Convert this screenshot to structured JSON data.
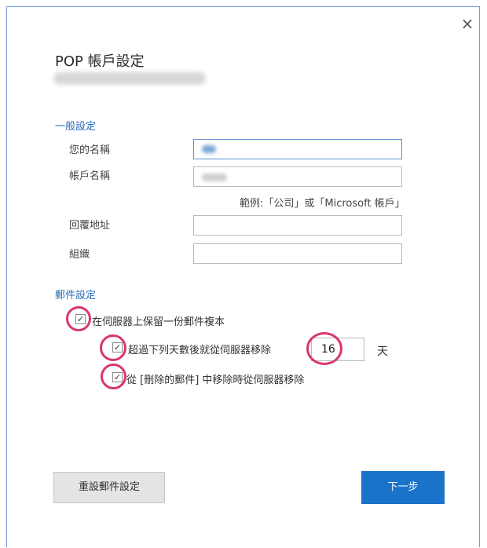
{
  "dialog": {
    "close_glyph": "×",
    "title": "POP 帳戶設定"
  },
  "general": {
    "section_title": "一般設定",
    "your_name_label": "您的名稱",
    "account_name_label": "帳戶名稱",
    "example_hint": "範例:「公司」或「Microsoft 帳戶」",
    "reply_address_label": "回覆地址",
    "organization_label": "組織"
  },
  "mail": {
    "section_title": "郵件設定",
    "keep_copy_label": "在伺服器上保留一份郵件複本",
    "keep_copy_checked": true,
    "remove_after_label": "超過下列天數後就從伺服器移除",
    "remove_after_checked": true,
    "days_value": "16",
    "days_unit": "天",
    "remove_on_delete_label": "從 [刪除的郵件] 中移除時從伺服器移除",
    "remove_on_delete_checked": true,
    "check_glyph": "✓"
  },
  "buttons": {
    "reset_label": "重設郵件設定",
    "next_label": "下一步"
  },
  "colors": {
    "accent": "#1a73c9",
    "section_title": "#2b6cb8",
    "highlight_circle": "#d9376a"
  }
}
